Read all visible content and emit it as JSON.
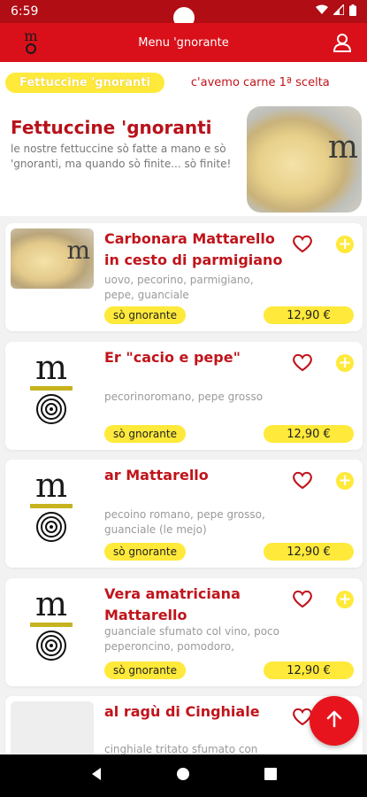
{
  "status_bar": {
    "time": "6:59"
  },
  "header": {
    "title": "Menu 'gnorante"
  },
  "tabs": {
    "active": "Fettuccine 'gnoranti",
    "other": "c'avemo carne 1ª scelta"
  },
  "category": {
    "title": "Fettuccine 'gnoranti",
    "description": "le nostre fettuccine sò fatte a mano e sò 'gnoranti, ma quando sò finite... sò finite!"
  },
  "items": [
    {
      "name": "Carbonara Mattarello in cesto di parmigiano",
      "ingredients": "uovo, pecorino, parmigiano, pepe, guanciale",
      "badge": "sò gnorante",
      "price": "12,90 €"
    },
    {
      "name": "Er \"cacio e pepe\"",
      "ingredients": "pecorinoromano, pepe grosso",
      "badge": "sò gnorante",
      "price": "12,90 €"
    },
    {
      "name": "ar Mattarello",
      "ingredients": "pecoino romano, pepe grosso, guanciale (le mejo)",
      "badge": "sò gnorante",
      "price": "12,90 €"
    },
    {
      "name": "Vera amatriciana Mattarello",
      "ingredients": "guanciale sfumato col vino, poco peperoncino, pomodoro,",
      "badge": "sò gnorante",
      "price": "12,90 €"
    },
    {
      "name": "al ragù di Cinghiale",
      "ingredients": "cinghiale tritato sfumato con"
    }
  ],
  "icons": {
    "logo": "mattarello-logo",
    "user": "user-icon",
    "heart": "heart-icon",
    "add": "plus-icon",
    "fab": "arrow-up-icon"
  },
  "colors": {
    "brand_red": "#d9101a",
    "accent_yellow": "#ffe93a",
    "name_red": "#c0141b"
  }
}
